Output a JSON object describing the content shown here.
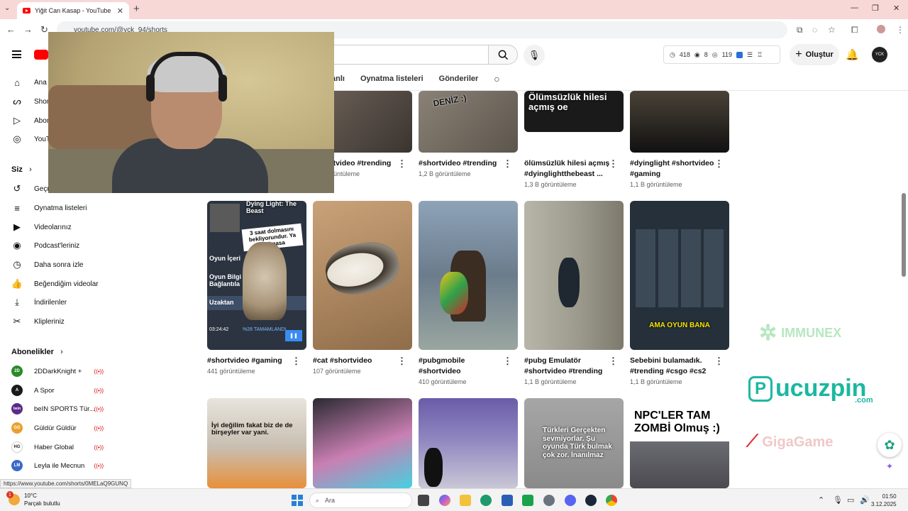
{
  "browser": {
    "tab_title": "Yiğit Can Kasap - YouTube",
    "url": "youtube.com/@yck_94/shorts"
  },
  "topbar": {
    "stats": {
      "views": "418",
      "watching": "8",
      "eye": "119"
    },
    "create_label": "Oluştur",
    "avatar_text": "YCK"
  },
  "sidebar": {
    "items": [
      {
        "label": "Ana sayfa",
        "icon": "home-icon"
      },
      {
        "label": "Shorts",
        "icon": "shorts-icon"
      },
      {
        "label": "Abonelikler",
        "icon": "subscriptions-icon"
      },
      {
        "label": "YouTube Music",
        "icon": "music-icon"
      }
    ],
    "you_heading": "Siz",
    "you_items": [
      {
        "label": "Geçmiş",
        "icon": "history-icon"
      },
      {
        "label": "Oynatma listeleri",
        "icon": "playlist-icon"
      },
      {
        "label": "Videolarınız",
        "icon": "video-icon"
      },
      {
        "label": "Podcast'leriniz",
        "icon": "podcast-icon"
      },
      {
        "label": "Daha sonra izle",
        "icon": "clock-icon"
      },
      {
        "label": "Beğendiğim videolar",
        "icon": "like-icon"
      },
      {
        "label": "İndirilenler",
        "icon": "download-icon"
      },
      {
        "label": "Klipleriniz",
        "icon": "scissors-icon"
      }
    ],
    "subs_heading": "Abonelikler",
    "subscriptions": [
      {
        "name": "2DDarkKnight +",
        "color": "#2a8a2a",
        "badge": "2D"
      },
      {
        "name": "A Spor",
        "color": "#1a1a1a",
        "badge": "A"
      },
      {
        "name": "beIN SPORTS Tür...",
        "color": "#5b2a8a",
        "badge": "bein"
      },
      {
        "name": "Güldür Güldür",
        "color": "#e8a030",
        "badge": "GG"
      },
      {
        "name": "Haber Global",
        "color": "#ffffff",
        "badge": "HG"
      },
      {
        "name": "Leyla ile Mecnun",
        "color": "#3a6ac8",
        "badge": "LM"
      }
    ]
  },
  "channel_tabs": [
    "Canlı",
    "Oynatma listeleri",
    "Gönderiler"
  ],
  "row1": [
    {
      "title": "#shortvideo #trending",
      "views": "1 B görüntüleme",
      "caption": ""
    },
    {
      "title": "#shortvideo #trending",
      "views": "1,2 B görüntüleme",
      "caption": "DENİZ :)"
    },
    {
      "title": "ölümsüzlük hilesi açmış #dyinglightthebeast ...",
      "views": "1,3 B görüntüleme",
      "caption": "Ölümsüzlük hilesi açmış oe"
    },
    {
      "title": "#dyinglight #shortvideo #gaming",
      "views": "1,1 B görüntüleme",
      "caption": ""
    }
  ],
  "row2": [
    {
      "title": "#shortvideo #gaming",
      "views": "441 görüntüleme",
      "caption": "Dying Light: The Beast"
    },
    {
      "title": "#cat #shortvideo",
      "views": "107 görüntüleme",
      "caption": ""
    },
    {
      "title": "#pubgmobile #shortvideo",
      "views": "410 görüntüleme",
      "caption": ""
    },
    {
      "title": "#pubg Emulatör #shortvideo #trending",
      "views": "1,1 B görüntüleme",
      "caption": ""
    },
    {
      "title": "Sebebini bulamadık. #trending #csgo #cs2",
      "views": "1,1 B görüntüleme",
      "caption": "AMA OYUN BANA"
    }
  ],
  "row3": [
    {
      "caption": "İyi değilim fakat biz de de birşeyler var yani."
    },
    {
      "caption": ""
    },
    {
      "caption": ""
    },
    {
      "caption": "Türkleri Gerçekten sevmiyorlar. Şu oyunda Türk bulmak çok zor. İnanılmaz"
    },
    {
      "caption": "NPC'LER TAM ZOMBİ Olmuş :)"
    }
  ],
  "short1_overlay": {
    "sticker": "3 saat dolmasını bekliyorundur. Ya açılmasa",
    "menu": [
      "Oyun İçeri",
      "Oyun Bilgi Bağlantıla",
      "Uzaktan"
    ],
    "progress_time": "03:24:42",
    "progress_pct": "%28 TAMAMLANDI"
  },
  "promos": {
    "p1": "IMMUNEX",
    "p2": "ucuzpin",
    "p2_sub": ".com",
    "p3": "GigaGame"
  },
  "status_url": "https://www.youtube.com/shorts/0MELaQ9GUNQ",
  "taskbar": {
    "temp": "10°C",
    "weather": "Parçalı bulutlu",
    "search_placeholder": "Ara",
    "time": "01:50",
    "date": "3.12.2025",
    "notification_count": "1"
  }
}
